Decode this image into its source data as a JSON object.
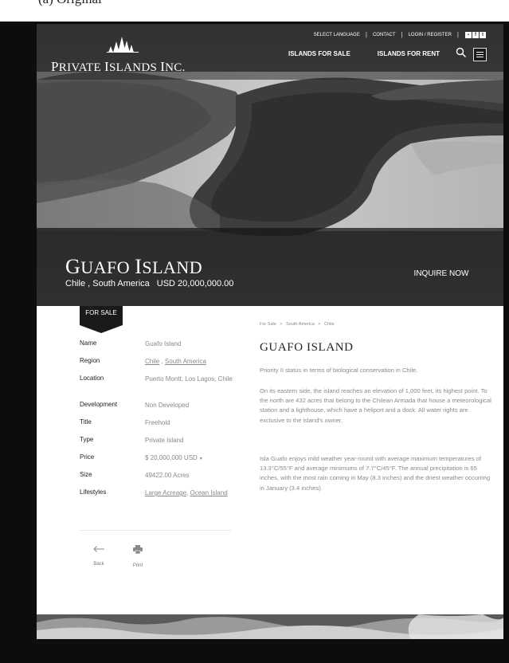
{
  "top_text": "(a) Original",
  "header": {
    "logo": {
      "line1_cap": "P",
      "line1": "RIVATE ",
      "cap2": "I",
      "line2": "SLANDS ",
      "cap3": "I",
      "line3": "NC."
    },
    "utility_nav": [
      "SELECT LANGUAGE",
      "CONTACT",
      "LOGIN / REGISTER"
    ],
    "social_icons": [
      "square-icon",
      "facebook-icon",
      "twitter-icon"
    ],
    "main_nav": [
      "ISLANDS FOR SALE",
      "ISLANDS FOR RENT"
    ]
  },
  "hero": {
    "title_cap": "G",
    "title_rest": "UAFO ",
    "title_cap2": "I",
    "title_rest2": "SLAND",
    "location": "Chile , South America",
    "price": "USD 20,000,000.00",
    "inquire_label": "INQUIRE NOW"
  },
  "badge": "FOR SALE",
  "details": [
    {
      "key": "Name",
      "value": "Guafo Island"
    },
    {
      "key": "Region",
      "links": [
        "Chile",
        "South America"
      ],
      "sep": " , "
    },
    {
      "key": "Location",
      "value": "Puerto Montt, Los Lagos, Chile"
    },
    {
      "key": "Development",
      "value": "Non Developed"
    },
    {
      "key": "Title",
      "value": "Freehold"
    },
    {
      "key": "Type",
      "value": "Private Island"
    },
    {
      "key": "Price",
      "value": "$ 20,000,000  USD",
      "caret": "▾"
    },
    {
      "key": "Size",
      "value": "49422.00 Acres"
    },
    {
      "key": "Lifestyles",
      "links": [
        "Large Acreage",
        "Ocean Island"
      ],
      "sep": ", "
    }
  ],
  "actions": {
    "back": "Back",
    "print": "Print"
  },
  "breadcrumb": [
    "For Sale",
    "South America",
    "Chile"
  ],
  "breadcrumb_sep": ">",
  "main": {
    "title": "GUAFO ISLAND",
    "paragraphs": [
      "Priority II status in terms of biological conservation in Chile.",
      "On its eastern side, the island reaches an elevation of 1,000 feet, its highest point. To the north are 432 acres that belong to the Chilean Armada that house a meteorological station and a lighthouse, which have a heliport and a dock. All water rights are exclusive to the island's owner.",
      "Isla Guafo enjoys mild weather year-round with average maximum temperatures of 13.3°C/55°F and average minimums of 7.7°C/45°F. The annual precipitation is 65 inches, with the most rain coming in May (8.3 inches) and the driest weather occurring in January (3.4 inches)."
    ]
  },
  "colors": {
    "frame": "#0d0d0d",
    "badge": "#1a1a1a",
    "text_dark": "#222222",
    "text_muted": "#888888"
  }
}
